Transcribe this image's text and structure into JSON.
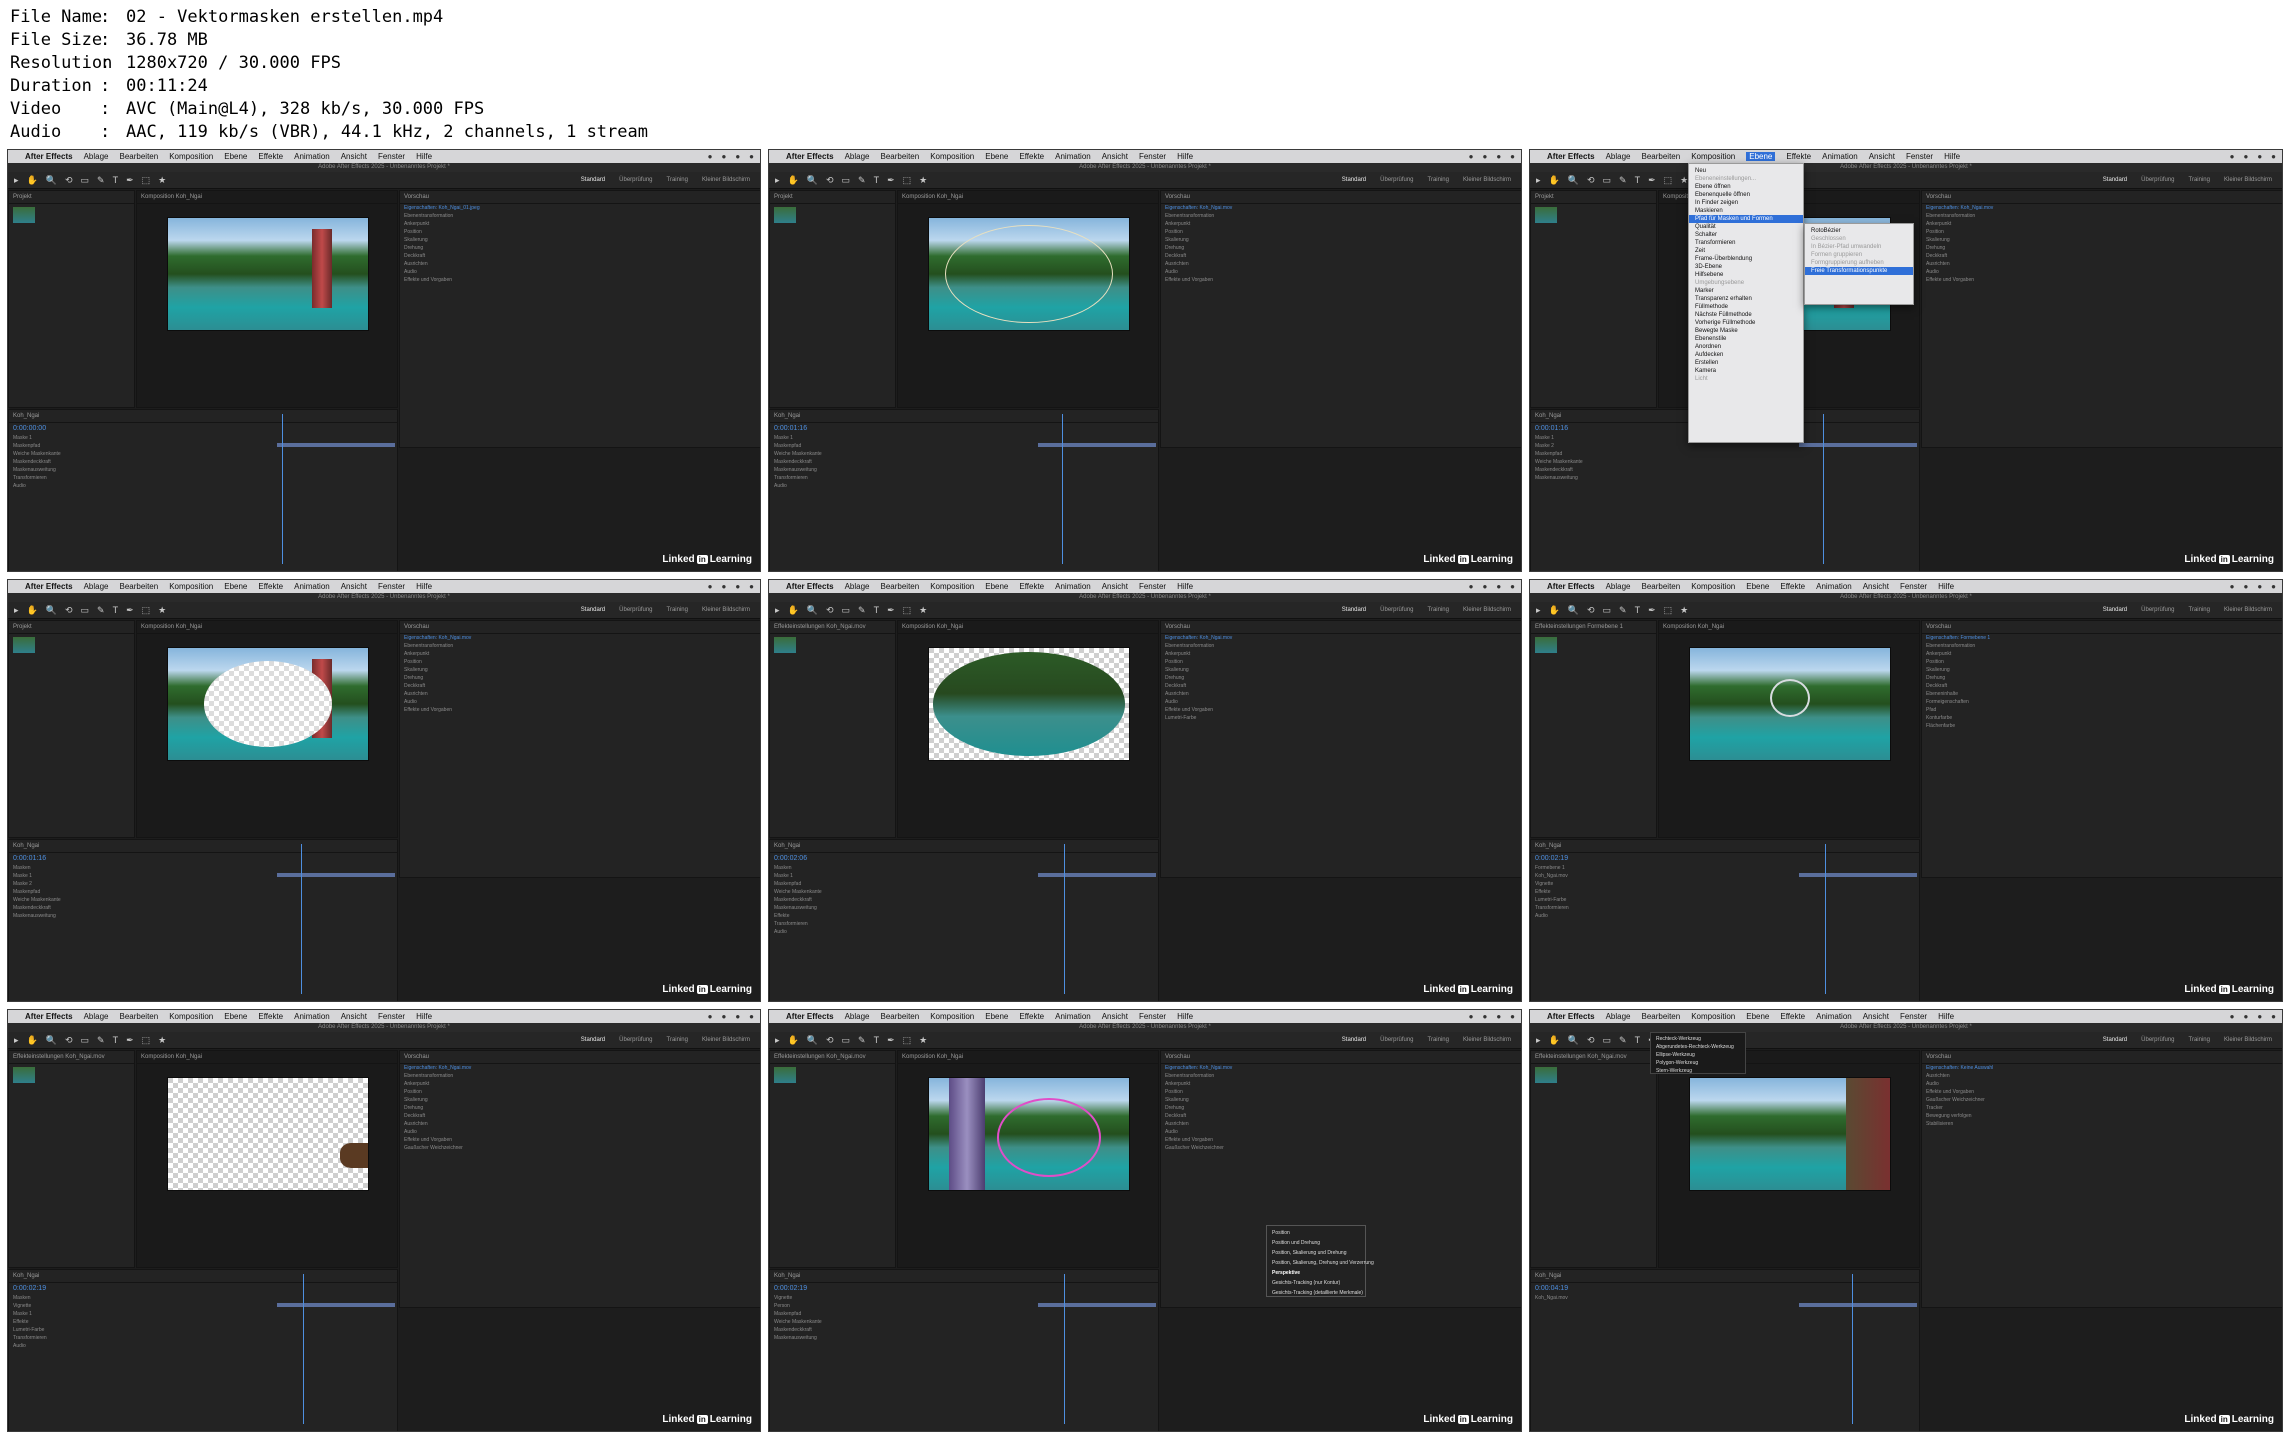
{
  "info": {
    "file_name": {
      "key": "File Name",
      "value": "02 - Vektormasken erstellen.mp4"
    },
    "file_size": {
      "key": "File Size",
      "value": "36.78 MB"
    },
    "resolution": {
      "key": "Resolution",
      "value": "1280x720 / 30.000 FPS"
    },
    "duration": {
      "key": "Duration",
      "value": "00:11:24"
    },
    "video": {
      "key": "Video",
      "value": "AVC (Main@L4), 328 kb/s, 30.000 FPS"
    },
    "audio": {
      "key": "Audio",
      "value": "AAC, 119 kb/s (VBR), 44.1 kHz, 2 channels, 1 stream"
    },
    "sep": ":"
  },
  "app": {
    "apple": "",
    "name": "After Effects",
    "menu": [
      "Ablage",
      "Bearbeiten",
      "Komposition",
      "Ebene",
      "Effekte",
      "Animation",
      "Ansicht",
      "Fenster",
      "Hilfe"
    ],
    "window_title": "Adobe After Effects 2025 - Unbenanntes Projekt *",
    "workspaces": [
      "Standard",
      "Überprüfung",
      "Training",
      "Kleiner Bildschirm"
    ],
    "tools": [
      "▸",
      "✋",
      "🔍",
      "⟲",
      "▭",
      "✎",
      "T",
      "✒",
      "⬚",
      "★"
    ],
    "linkedin_word": "Linked",
    "linkedin_in": "in",
    "linkedin_suffix": "Learning"
  },
  "tiles": [
    {
      "project_title": "Projekt",
      "comp_title": "Komposition Koh_Ngai",
      "props_title": "Vorschau",
      "props_sub": "Eigenschaften: Koh_Ngai_01.jpeg",
      "props_lines": [
        "Ebenentransformation",
        "Ankerpunkt",
        "Position",
        "Skalierung",
        "Drehung",
        "Deckkraft",
        "Ausrichten",
        "Audio",
        "Effekte und Vorgaben"
      ],
      "tl_title": "Koh_Ngai",
      "timecode": "0:00:00:00",
      "tl_lines": [
        "Maske 1",
        "Maskenpfad",
        "Weiche Maskenkante",
        "Maskendeckkraft",
        "Maskenausweitung",
        "Transformieren",
        "Audio"
      ],
      "viewer": "photo",
      "playhead": 4
    },
    {
      "project_title": "Projekt",
      "comp_title": "Komposition Koh_Ngai",
      "props_title": "Vorschau",
      "props_sub": "Eigenschaften: Koh_Ngai.mov",
      "props_lines": [
        "Ebenentransformation",
        "Ankerpunkt",
        "Position",
        "Skalierung",
        "Drehung",
        "Deckkraft",
        "Ausrichten",
        "Audio",
        "Effekte und Vorgaben"
      ],
      "tl_title": "Koh_Ngai",
      "timecode": "0:00:01:16",
      "tl_lines": [
        "Maske 1",
        "Maskenpfad",
        "Weiche Maskenkante",
        "Maskendeckkraft",
        "Maskenausweitung",
        "Transformieren",
        "Audio"
      ],
      "viewer": "oval",
      "playhead": 20
    },
    {
      "project_title": "Projekt",
      "comp_title": "Komposition Koh_Ngai",
      "props_title": "Vorschau",
      "props_sub": "Eigenschaften: Koh_Ngai.mov",
      "props_lines": [
        "Ebenentransformation",
        "Ankerpunkt",
        "Position",
        "Skalierung",
        "Drehung",
        "Deckkraft",
        "Ausrichten",
        "Audio",
        "Effekte und Vorgaben"
      ],
      "tl_title": "Koh_Ngai",
      "timecode": "0:00:01:16",
      "tl_lines": [
        "Maske 1",
        "Maske 2",
        "Maskenpfad",
        "Weiche Maskenkante",
        "Maskendeckkraft",
        "Maskenausweitung"
      ],
      "viewer": "photo",
      "playhead": 20,
      "menu": [
        "Neu",
        "Ebeneneinstellungen...",
        "Ebene öffnen",
        "Ebenenquelle öffnen",
        "In Finder zeigen",
        "Maskieren",
        "Pfad für Masken und Formen",
        "Qualität",
        "Schalter",
        "Transformieren",
        "Zeit",
        "Frame-Überblendung",
        "3D-Ebene",
        "Hilfsebene",
        "Umgebungsebene",
        "Marker",
        "Transparenz erhalten",
        "Füllmethode",
        "Nächste Füllmethode",
        "Vorherige Füllmethode",
        "Bewegte Maske",
        "Ebenenstile",
        "Anordnen",
        "Aufdecken",
        "Erstellen",
        "Kamera",
        "Licht"
      ],
      "submenu": [
        "RotoBézier",
        "Geschlossen",
        "In Bézier-Pfad umwandeln",
        "Formen gruppieren",
        "Formgruppierung aufheben",
        "Freie Transformationspunkte"
      ]
    },
    {
      "project_title": "Projekt",
      "comp_title": "Komposition Koh_Ngai",
      "props_title": "Vorschau",
      "props_sub": "Eigenschaften: Koh_Ngai.mov",
      "props_lines": [
        "Ebenentransformation",
        "Ankerpunkt",
        "Position",
        "Skalierung",
        "Drehung",
        "Deckkraft",
        "Ausrichten",
        "Audio",
        "Effekte und Vorgaben"
      ],
      "tl_title": "Koh_Ngai",
      "timecode": "0:00:01:16",
      "tl_lines": [
        "Masken",
        "Maske 1",
        "Maske 2",
        "Maskenpfad",
        "Weiche Maskenkante",
        "Maskendeckkraft",
        "Maskenausweitung"
      ],
      "viewer": "hole",
      "playhead": 20
    },
    {
      "project_title": "Effekteinstellungen Koh_Ngai.mov",
      "comp_title": "Komposition Koh_Ngai",
      "props_title": "Vorschau",
      "props_sub": "Eigenschaften: Koh_Ngai.mov",
      "props_lines": [
        "Ebenentransformation",
        "Ankerpunkt",
        "Position",
        "Skalierung",
        "Drehung",
        "Deckkraft",
        "Ausrichten",
        "Audio",
        "Effekte und Vorgaben",
        "Lumetri-Farbe"
      ],
      "tl_title": "Koh_Ngai",
      "timecode": "0:00:02:06",
      "tl_lines": [
        "Masken",
        "Maske 1",
        "Maskenpfad",
        "Weiche Maskenkante",
        "Maskendeckkraft",
        "Maskenausweitung",
        "Effekte",
        "Transformieren",
        "Audio"
      ],
      "viewer": "blackellipse",
      "playhead": 22
    },
    {
      "project_title": "Effekteinstellungen Formebene 1",
      "comp_title": "Komposition Koh_Ngai",
      "props_title": "Vorschau",
      "props_sub": "Eigenschaften: Formebene 1",
      "props_lines": [
        "Ebenentransformation",
        "Ankerpunkt",
        "Position",
        "Skalierung",
        "Drehung",
        "Deckkraft",
        "Ebeneninhalte",
        "Formeigenschaften",
        "Pfad",
        "Konturfarbe",
        "Flächenfarbe"
      ],
      "tl_title": "Koh_Ngai",
      "timecode": "0:00:02:19",
      "tl_lines": [
        "Formebene 1",
        "Koh_Ngai.mov",
        "Vignette",
        "Effekte",
        "Lumetri-Farbe",
        "Transformieren",
        "Audio"
      ],
      "viewer": "ring",
      "playhead": 22
    },
    {
      "project_title": "Effekteinstellungen Koh_Ngai.mov",
      "comp_title": "Komposition Koh_Ngai",
      "props_title": "Vorschau",
      "props_sub": "Eigenschaften: Koh_Ngai.mov",
      "props_lines": [
        "Ebenentransformation",
        "Ankerpunkt",
        "Position",
        "Skalierung",
        "Drehung",
        "Deckkraft",
        "Ausrichten",
        "Audio",
        "Effekte und Vorgaben",
        "Gaußscher Weichzeichner"
      ],
      "tl_title": "Koh_Ngai",
      "timecode": "0:00:02:19",
      "tl_lines": [
        "Masken",
        "Vignette",
        "Maske 1",
        "Effekte",
        "Lumetri-Farbe",
        "Transformieren",
        "Audio"
      ],
      "viewer": "checker",
      "playhead": 22
    },
    {
      "project_title": "Effekteinstellungen Koh_Ngai.mov",
      "comp_title": "Komposition Koh_Ngai",
      "props_title": "Vorschau",
      "props_sub": "Eigenschaften: Koh_Ngai.mov",
      "props_lines": [
        "Ebenentransformation",
        "Ankerpunkt",
        "Position",
        "Skalierung",
        "Drehung",
        "Deckkraft",
        "Ausrichten",
        "Audio",
        "Effekte und Vorgaben",
        "Gaußscher Weichzeichner"
      ],
      "tl_title": "Koh_Ngai",
      "timecode": "0:00:02:19",
      "tl_lines": [
        "Vignette",
        "Person",
        "Maskenpfad",
        "Weiche Maskenkante",
        "Maskendeckkraft",
        "Maskenausweitung"
      ],
      "viewer": "pink",
      "playhead": 22,
      "popup": [
        "Position",
        "Position und Drehung",
        "Position, Skalierung und Drehung",
        "Position, Skalierung, Drehung und Verzerrung",
        "Perspektive",
        "Gesichts-Tracking (nur Kontur)",
        "Gesichts-Tracking (detaillierte Merkmale)"
      ]
    },
    {
      "project_title": "Effekteinstellungen Koh_Ngai.mov",
      "comp_title": "Komposition Koh_Ngai",
      "props_title": "Vorschau",
      "props_sub": "Eigenschaften: Keine Auswahl",
      "props_lines": [
        "Ausrichten",
        "Audio",
        "Effekte und Vorgaben",
        "Gaußscher Weichzeichner",
        "Tracker",
        "Bewegung verfolgen",
        "Stabilisieren"
      ],
      "tl_title": "Koh_Ngai",
      "timecode": "0:00:04:19",
      "tl_lines": [
        "Koh_Ngai.mov"
      ],
      "viewer": "photo2",
      "playhead": 45,
      "tooldd": [
        "Rechteck-Werkzeug",
        "Abgerundetes-Rechteck-Werkzeug",
        "Ellipse-Werkzeug",
        "Polygon-Werkzeug",
        "Stern-Werkzeug"
      ]
    }
  ]
}
